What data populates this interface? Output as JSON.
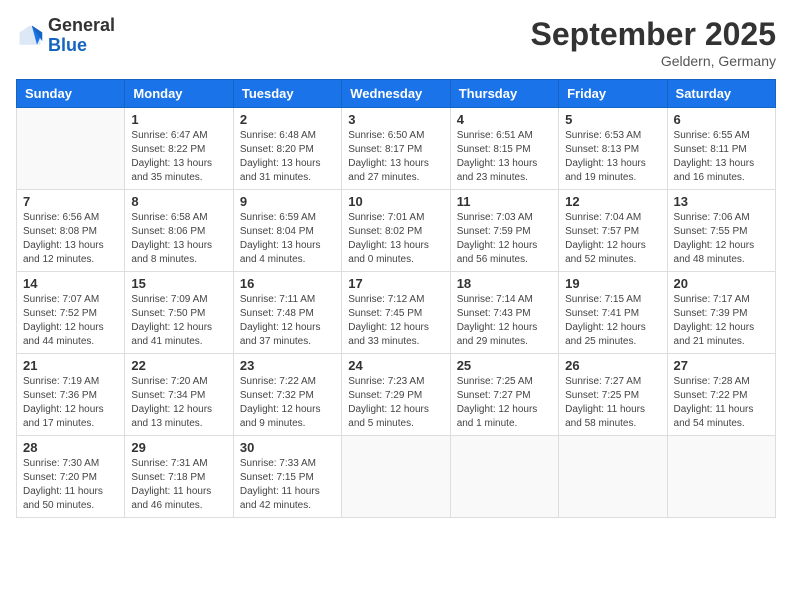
{
  "header": {
    "logo_line1": "General",
    "logo_line2": "Blue",
    "month": "September 2025",
    "location": "Geldern, Germany"
  },
  "weekdays": [
    "Sunday",
    "Monday",
    "Tuesday",
    "Wednesday",
    "Thursday",
    "Friday",
    "Saturday"
  ],
  "weeks": [
    [
      {
        "day": "",
        "info": ""
      },
      {
        "day": "1",
        "info": "Sunrise: 6:47 AM\nSunset: 8:22 PM\nDaylight: 13 hours\nand 35 minutes."
      },
      {
        "day": "2",
        "info": "Sunrise: 6:48 AM\nSunset: 8:20 PM\nDaylight: 13 hours\nand 31 minutes."
      },
      {
        "day": "3",
        "info": "Sunrise: 6:50 AM\nSunset: 8:17 PM\nDaylight: 13 hours\nand 27 minutes."
      },
      {
        "day": "4",
        "info": "Sunrise: 6:51 AM\nSunset: 8:15 PM\nDaylight: 13 hours\nand 23 minutes."
      },
      {
        "day": "5",
        "info": "Sunrise: 6:53 AM\nSunset: 8:13 PM\nDaylight: 13 hours\nand 19 minutes."
      },
      {
        "day": "6",
        "info": "Sunrise: 6:55 AM\nSunset: 8:11 PM\nDaylight: 13 hours\nand 16 minutes."
      }
    ],
    [
      {
        "day": "7",
        "info": "Sunrise: 6:56 AM\nSunset: 8:08 PM\nDaylight: 13 hours\nand 12 minutes."
      },
      {
        "day": "8",
        "info": "Sunrise: 6:58 AM\nSunset: 8:06 PM\nDaylight: 13 hours\nand 8 minutes."
      },
      {
        "day": "9",
        "info": "Sunrise: 6:59 AM\nSunset: 8:04 PM\nDaylight: 13 hours\nand 4 minutes."
      },
      {
        "day": "10",
        "info": "Sunrise: 7:01 AM\nSunset: 8:02 PM\nDaylight: 13 hours\nand 0 minutes."
      },
      {
        "day": "11",
        "info": "Sunrise: 7:03 AM\nSunset: 7:59 PM\nDaylight: 12 hours\nand 56 minutes."
      },
      {
        "day": "12",
        "info": "Sunrise: 7:04 AM\nSunset: 7:57 PM\nDaylight: 12 hours\nand 52 minutes."
      },
      {
        "day": "13",
        "info": "Sunrise: 7:06 AM\nSunset: 7:55 PM\nDaylight: 12 hours\nand 48 minutes."
      }
    ],
    [
      {
        "day": "14",
        "info": "Sunrise: 7:07 AM\nSunset: 7:52 PM\nDaylight: 12 hours\nand 44 minutes."
      },
      {
        "day": "15",
        "info": "Sunrise: 7:09 AM\nSunset: 7:50 PM\nDaylight: 12 hours\nand 41 minutes."
      },
      {
        "day": "16",
        "info": "Sunrise: 7:11 AM\nSunset: 7:48 PM\nDaylight: 12 hours\nand 37 minutes."
      },
      {
        "day": "17",
        "info": "Sunrise: 7:12 AM\nSunset: 7:45 PM\nDaylight: 12 hours\nand 33 minutes."
      },
      {
        "day": "18",
        "info": "Sunrise: 7:14 AM\nSunset: 7:43 PM\nDaylight: 12 hours\nand 29 minutes."
      },
      {
        "day": "19",
        "info": "Sunrise: 7:15 AM\nSunset: 7:41 PM\nDaylight: 12 hours\nand 25 minutes."
      },
      {
        "day": "20",
        "info": "Sunrise: 7:17 AM\nSunset: 7:39 PM\nDaylight: 12 hours\nand 21 minutes."
      }
    ],
    [
      {
        "day": "21",
        "info": "Sunrise: 7:19 AM\nSunset: 7:36 PM\nDaylight: 12 hours\nand 17 minutes."
      },
      {
        "day": "22",
        "info": "Sunrise: 7:20 AM\nSunset: 7:34 PM\nDaylight: 12 hours\nand 13 minutes."
      },
      {
        "day": "23",
        "info": "Sunrise: 7:22 AM\nSunset: 7:32 PM\nDaylight: 12 hours\nand 9 minutes."
      },
      {
        "day": "24",
        "info": "Sunrise: 7:23 AM\nSunset: 7:29 PM\nDaylight: 12 hours\nand 5 minutes."
      },
      {
        "day": "25",
        "info": "Sunrise: 7:25 AM\nSunset: 7:27 PM\nDaylight: 12 hours\nand 1 minute."
      },
      {
        "day": "26",
        "info": "Sunrise: 7:27 AM\nSunset: 7:25 PM\nDaylight: 11 hours\nand 58 minutes."
      },
      {
        "day": "27",
        "info": "Sunrise: 7:28 AM\nSunset: 7:22 PM\nDaylight: 11 hours\nand 54 minutes."
      }
    ],
    [
      {
        "day": "28",
        "info": "Sunrise: 7:30 AM\nSunset: 7:20 PM\nDaylight: 11 hours\nand 50 minutes."
      },
      {
        "day": "29",
        "info": "Sunrise: 7:31 AM\nSunset: 7:18 PM\nDaylight: 11 hours\nand 46 minutes."
      },
      {
        "day": "30",
        "info": "Sunrise: 7:33 AM\nSunset: 7:15 PM\nDaylight: 11 hours\nand 42 minutes."
      },
      {
        "day": "",
        "info": ""
      },
      {
        "day": "",
        "info": ""
      },
      {
        "day": "",
        "info": ""
      },
      {
        "day": "",
        "info": ""
      }
    ]
  ]
}
